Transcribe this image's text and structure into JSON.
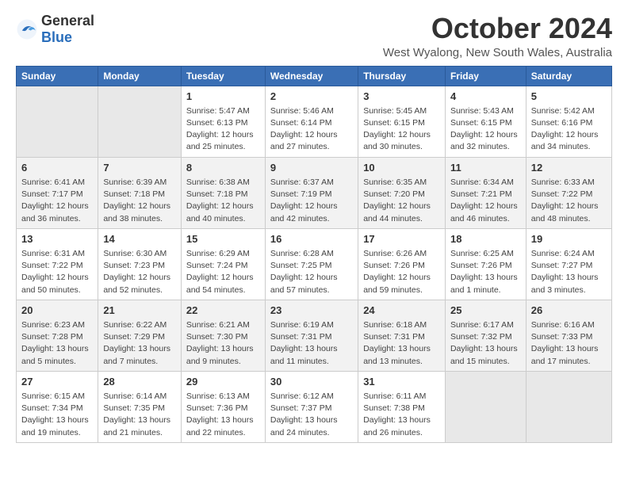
{
  "logo": {
    "general": "General",
    "blue": "Blue"
  },
  "title": "October 2024",
  "subtitle": "West Wyalong, New South Wales, Australia",
  "days_header": [
    "Sunday",
    "Monday",
    "Tuesday",
    "Wednesday",
    "Thursday",
    "Friday",
    "Saturday"
  ],
  "weeks": [
    [
      {
        "day": "",
        "info": ""
      },
      {
        "day": "",
        "info": ""
      },
      {
        "day": "1",
        "info": "Sunrise: 5:47 AM\nSunset: 6:13 PM\nDaylight: 12 hours and 25 minutes."
      },
      {
        "day": "2",
        "info": "Sunrise: 5:46 AM\nSunset: 6:14 PM\nDaylight: 12 hours and 27 minutes."
      },
      {
        "day": "3",
        "info": "Sunrise: 5:45 AM\nSunset: 6:15 PM\nDaylight: 12 hours and 30 minutes."
      },
      {
        "day": "4",
        "info": "Sunrise: 5:43 AM\nSunset: 6:15 PM\nDaylight: 12 hours and 32 minutes."
      },
      {
        "day": "5",
        "info": "Sunrise: 5:42 AM\nSunset: 6:16 PM\nDaylight: 12 hours and 34 minutes."
      }
    ],
    [
      {
        "day": "6",
        "info": "Sunrise: 6:41 AM\nSunset: 7:17 PM\nDaylight: 12 hours and 36 minutes."
      },
      {
        "day": "7",
        "info": "Sunrise: 6:39 AM\nSunset: 7:18 PM\nDaylight: 12 hours and 38 minutes."
      },
      {
        "day": "8",
        "info": "Sunrise: 6:38 AM\nSunset: 7:18 PM\nDaylight: 12 hours and 40 minutes."
      },
      {
        "day": "9",
        "info": "Sunrise: 6:37 AM\nSunset: 7:19 PM\nDaylight: 12 hours and 42 minutes."
      },
      {
        "day": "10",
        "info": "Sunrise: 6:35 AM\nSunset: 7:20 PM\nDaylight: 12 hours and 44 minutes."
      },
      {
        "day": "11",
        "info": "Sunrise: 6:34 AM\nSunset: 7:21 PM\nDaylight: 12 hours and 46 minutes."
      },
      {
        "day": "12",
        "info": "Sunrise: 6:33 AM\nSunset: 7:22 PM\nDaylight: 12 hours and 48 minutes."
      }
    ],
    [
      {
        "day": "13",
        "info": "Sunrise: 6:31 AM\nSunset: 7:22 PM\nDaylight: 12 hours and 50 minutes."
      },
      {
        "day": "14",
        "info": "Sunrise: 6:30 AM\nSunset: 7:23 PM\nDaylight: 12 hours and 52 minutes."
      },
      {
        "day": "15",
        "info": "Sunrise: 6:29 AM\nSunset: 7:24 PM\nDaylight: 12 hours and 54 minutes."
      },
      {
        "day": "16",
        "info": "Sunrise: 6:28 AM\nSunset: 7:25 PM\nDaylight: 12 hours and 57 minutes."
      },
      {
        "day": "17",
        "info": "Sunrise: 6:26 AM\nSunset: 7:26 PM\nDaylight: 12 hours and 59 minutes."
      },
      {
        "day": "18",
        "info": "Sunrise: 6:25 AM\nSunset: 7:26 PM\nDaylight: 13 hours and 1 minute."
      },
      {
        "day": "19",
        "info": "Sunrise: 6:24 AM\nSunset: 7:27 PM\nDaylight: 13 hours and 3 minutes."
      }
    ],
    [
      {
        "day": "20",
        "info": "Sunrise: 6:23 AM\nSunset: 7:28 PM\nDaylight: 13 hours and 5 minutes."
      },
      {
        "day": "21",
        "info": "Sunrise: 6:22 AM\nSunset: 7:29 PM\nDaylight: 13 hours and 7 minutes."
      },
      {
        "day": "22",
        "info": "Sunrise: 6:21 AM\nSunset: 7:30 PM\nDaylight: 13 hours and 9 minutes."
      },
      {
        "day": "23",
        "info": "Sunrise: 6:19 AM\nSunset: 7:31 PM\nDaylight: 13 hours and 11 minutes."
      },
      {
        "day": "24",
        "info": "Sunrise: 6:18 AM\nSunset: 7:31 PM\nDaylight: 13 hours and 13 minutes."
      },
      {
        "day": "25",
        "info": "Sunrise: 6:17 AM\nSunset: 7:32 PM\nDaylight: 13 hours and 15 minutes."
      },
      {
        "day": "26",
        "info": "Sunrise: 6:16 AM\nSunset: 7:33 PM\nDaylight: 13 hours and 17 minutes."
      }
    ],
    [
      {
        "day": "27",
        "info": "Sunrise: 6:15 AM\nSunset: 7:34 PM\nDaylight: 13 hours and 19 minutes."
      },
      {
        "day": "28",
        "info": "Sunrise: 6:14 AM\nSunset: 7:35 PM\nDaylight: 13 hours and 21 minutes."
      },
      {
        "day": "29",
        "info": "Sunrise: 6:13 AM\nSunset: 7:36 PM\nDaylight: 13 hours and 22 minutes."
      },
      {
        "day": "30",
        "info": "Sunrise: 6:12 AM\nSunset: 7:37 PM\nDaylight: 13 hours and 24 minutes."
      },
      {
        "day": "31",
        "info": "Sunrise: 6:11 AM\nSunset: 7:38 PM\nDaylight: 13 hours and 26 minutes."
      },
      {
        "day": "",
        "info": ""
      },
      {
        "day": "",
        "info": ""
      }
    ]
  ]
}
